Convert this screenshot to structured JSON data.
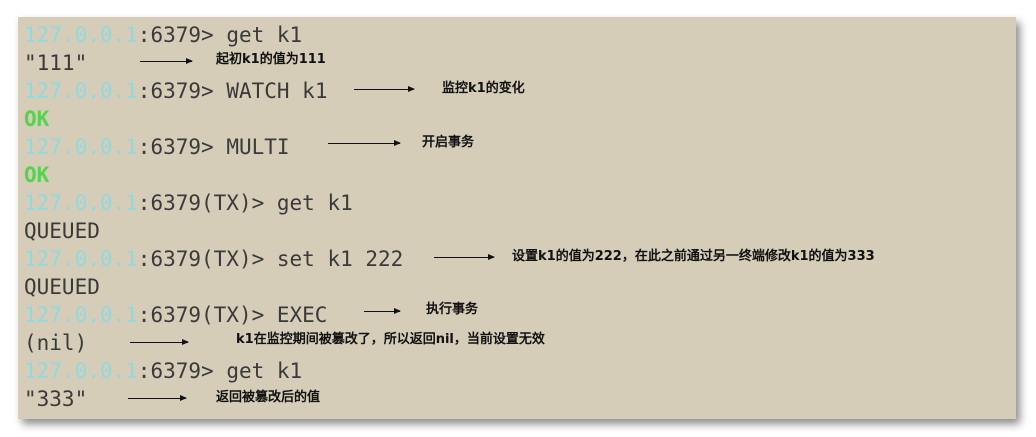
{
  "terminal": {
    "host": "127.0.0.1",
    "lines": [
      {
        "prompt": ":6379> ",
        "cmd": "get k1"
      },
      {
        "output": "\"111\""
      },
      {
        "prompt": ":6379> ",
        "cmd": "WATCH k1"
      },
      {
        "ok": "OK"
      },
      {
        "prompt": ":6379> ",
        "cmd": "MULTI"
      },
      {
        "ok": "OK"
      },
      {
        "prompt": ":6379(TX)> ",
        "cmd": "get k1"
      },
      {
        "output": "QUEUED"
      },
      {
        "prompt": ":6379(TX)> ",
        "cmd": "set k1 222"
      },
      {
        "output": "QUEUED"
      },
      {
        "prompt": ":6379(TX)> ",
        "cmd": "EXEC"
      },
      {
        "output": "(nil)"
      },
      {
        "prompt": ":6379> ",
        "cmd": "get k1"
      },
      {
        "output": "\"333\""
      }
    ]
  },
  "annotations": [
    "起初k1的值为111",
    "监控k1的变化",
    "开启事务",
    "设置k1的值为222，在此之前通过另一终端修改k1的值为333",
    "执行事务",
    "k1在监控期间被篡改了，所以返回nil，当前设置无效",
    "返回被篡改后的值"
  ]
}
